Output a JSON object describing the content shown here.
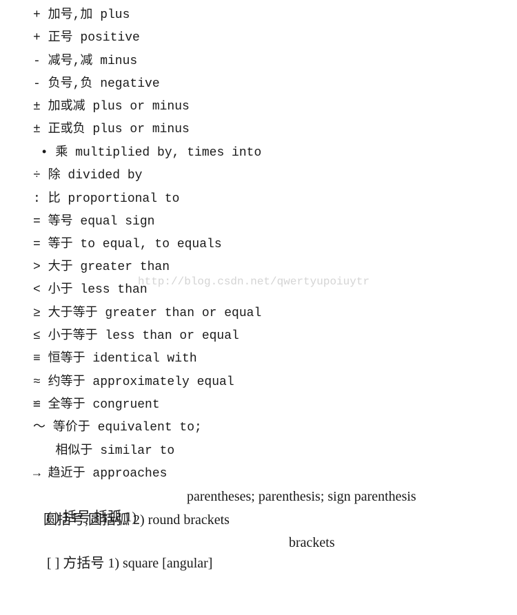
{
  "lines": [
    {
      "text": "+ 加号,加 plus"
    },
    {
      "text": "+ 正号 positive"
    },
    {
      "text": "- 减号,减 minus"
    },
    {
      "text": "- 负号,负 negative"
    },
    {
      "text": "± 加或减 plus or minus"
    },
    {
      "text": "± 正或负 plus or minus"
    },
    {
      "text": " • 乘 multiplied by, times into"
    },
    {
      "text": "÷ 除 divided by"
    },
    {
      "text": ": 比 proportional to"
    },
    {
      "text": "= 等号 equal sign"
    },
    {
      "text": "= 等于 to equal, to equals"
    },
    {
      "text": "> 大于 greater than"
    },
    {
      "text": "< 小于 less than"
    },
    {
      "text": "≥ 大于等于 greater than or equal"
    },
    {
      "text": "≤ 小于等于 less than or equal"
    },
    {
      "text": "≡ 恒等于 identical with"
    },
    {
      "text": "≈ 约等于 approximately equal"
    },
    {
      "text": "≌ 全等于 congruent"
    },
    {
      "text": "～ 等价于 equivalent to;"
    },
    {
      "text": "   相似于 similar to"
    },
    {
      "text": "→ 趋近于 approaches"
    },
    {
      "text": "( ) 括号,括弧 1)",
      "text2": "parentheses; parenthesis; sign parenthesis"
    },
    {
      "text": "   圆括号,圆括弧 2) round brackets"
    },
    {
      "text": "[ ] 方括号 1) square [angular]",
      "text2": "brackets"
    }
  ],
  "watermark": "http://blog.csdn.net/qwertyupoiuytr"
}
